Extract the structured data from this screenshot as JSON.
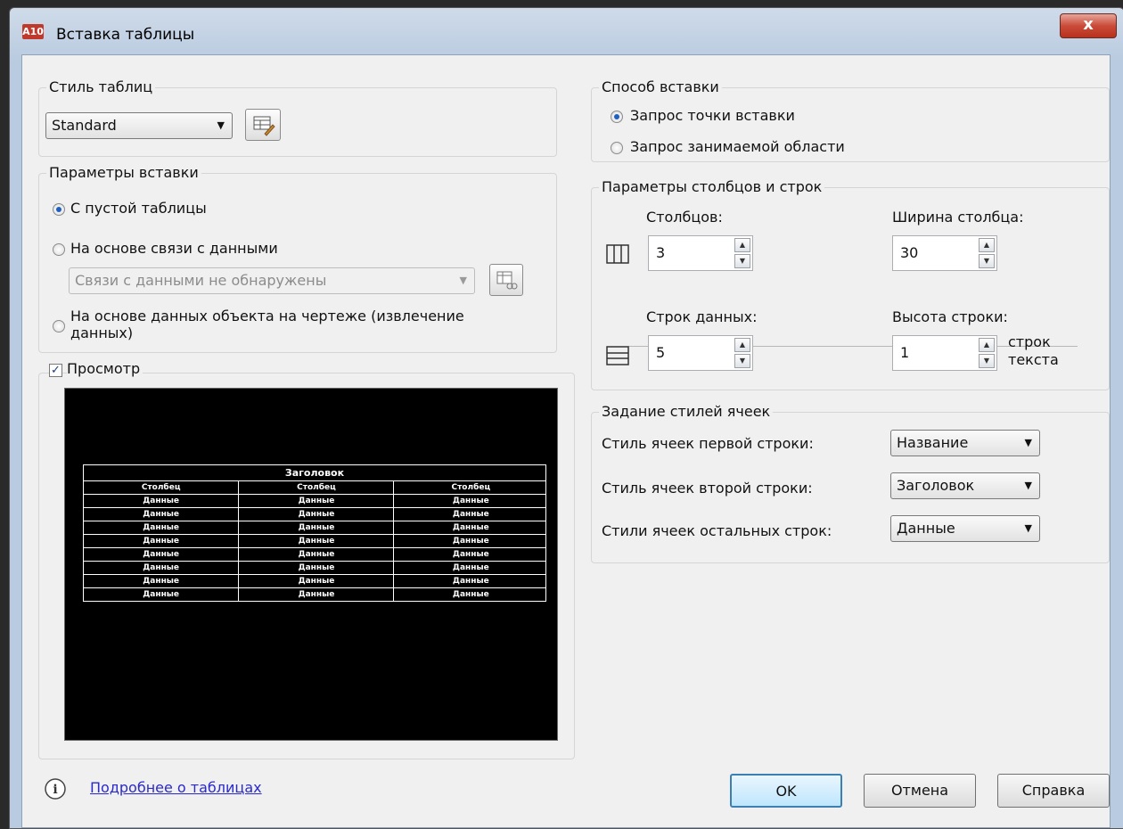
{
  "window": {
    "app_icon_text": "A10",
    "title": "Вставка таблицы",
    "close_glyph": "x"
  },
  "table_style": {
    "group_label": "Стиль таблиц",
    "selected": "Standard",
    "edit_icon": "table-style-edit-icon"
  },
  "insert_options": {
    "group_label": "Параметры вставки",
    "option_empty": "С пустой таблицы",
    "option_data_link": "На основе связи с данными",
    "data_link_combo": "Связи с данными не обнаружены",
    "option_object_data_line1": "На основе данных объекта на чертеже (извлечение",
    "option_object_data_line2": "данных)",
    "selected_option": "empty"
  },
  "preview": {
    "label": "Просмотр",
    "checked": true,
    "title_row": "Заголовок",
    "header_cells": [
      "Столбец",
      "Столбец",
      "Столбец"
    ],
    "data_cell": "Данные",
    "data_rows": 8
  },
  "insert_method": {
    "group_label": "Способ вставки",
    "option_point": "Запрос точки вставки",
    "option_window": "Запрос занимаемой области",
    "selected_option": "point"
  },
  "columns_rows": {
    "group_label": "Параметры столбцов и строк",
    "columns_label": "Столбцов:",
    "columns_value": "3",
    "column_width_label": "Ширина столбца:",
    "column_width_value": "30",
    "data_rows_label": "Строк данных:",
    "data_rows_value": "5",
    "row_height_label": "Высота строки:",
    "row_height_value": "1",
    "row_height_unit_line1": "строк",
    "row_height_unit_line2": "текста"
  },
  "cell_styles": {
    "group_label": "Задание стилей ячеек",
    "first_row_label": "Стиль ячеек первой строки:",
    "first_row_value": "Название",
    "second_row_label": "Стиль ячеек второй строки:",
    "second_row_value": "Заголовок",
    "other_rows_label": "Стили ячеек остальных строк:",
    "other_rows_value": "Данные"
  },
  "footer": {
    "info_icon": "info-icon",
    "help_link": "Подробнее о таблицах",
    "ok_label": "OK",
    "cancel_label": "Отмена",
    "help_label": "Справка"
  }
}
